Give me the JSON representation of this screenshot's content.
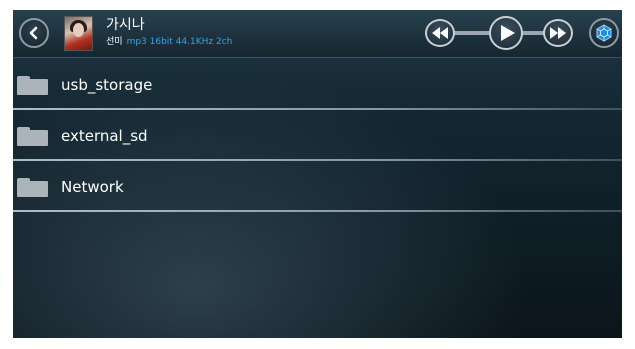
{
  "header": {
    "song_title": "가시나",
    "artist": "선미",
    "format_info": "mp3 16bit 44.1KHz 2ch"
  },
  "files": [
    {
      "label": "usb_storage"
    },
    {
      "label": "external_sd"
    },
    {
      "label": "Network"
    }
  ],
  "icons": {
    "back": "chevron-left-icon",
    "rewind": "rewind-icon",
    "play": "play-icon",
    "fast_forward": "fast-forward-icon",
    "menu": "hexagon-menu-icon",
    "folder": "folder-icon"
  },
  "colors": {
    "accent": "#3aa0e8",
    "background": "#132630",
    "text": "#ffffff"
  }
}
